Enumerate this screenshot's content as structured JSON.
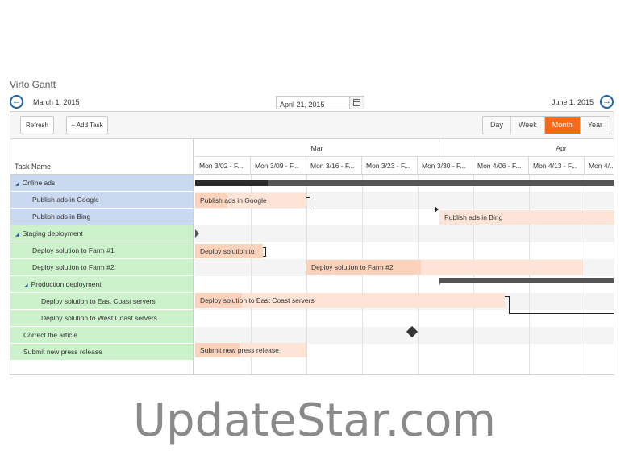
{
  "app": {
    "title": "Virto Gantt"
  },
  "nav": {
    "start_date": "March 1, 2015",
    "selected_date": "April 21, 2015",
    "end_date": "June 1, 2015"
  },
  "toolbar": {
    "refresh_label": "Refresh",
    "add_task_label": "+ Add Task",
    "views": [
      "Day",
      "Week",
      "Month",
      "Year"
    ],
    "active_view": "Month"
  },
  "task_list": {
    "header": "Task Name",
    "rows": [
      {
        "label": "Online ads",
        "color": "#c9d9ef"
      },
      {
        "label": "Publish ads in Google",
        "color": "#c9d9ef"
      },
      {
        "label": "Publish ads in Bing",
        "color": "#c9d9ef"
      },
      {
        "label": "Staging deployment",
        "color": "#ccf2cc"
      },
      {
        "label": "Deploy solution to Farm #1",
        "color": "#ccf2cc"
      },
      {
        "label": "Deploy solution to Farm #2",
        "color": "#ccf2cc"
      },
      {
        "label": "Production deployment",
        "color": "#ccf2cc"
      },
      {
        "label": "Deploy solution to East Coast servers",
        "color": "#ccf2cc"
      },
      {
        "label": "Deploy solution to West Coast servers",
        "color": "#ccf2cc"
      },
      {
        "label": "Correct the article",
        "color": "#ccf2cc"
      },
      {
        "label": "Submit new press release",
        "color": "#ccf2cc"
      }
    ]
  },
  "timeline": {
    "months": [
      "Mar",
      "Apr"
    ],
    "weeks": [
      "Mon 3/02 - F...",
      "Mon 3/09 - F...",
      "Mon 3/16 - F...",
      "Mon 3/23 - F...",
      "Mon 3/30 - F...",
      "Mon 4/06 - F...",
      "Mon 4/13 - F...",
      "Mon 4/..."
    ],
    "bars": {
      "google": "Publish ads in Google",
      "bing": "Publish ads in Bing",
      "farm1": "Deploy solution to",
      "farm2": "Deploy solution to Farm #2",
      "east": "Deploy solution to East Coast servers",
      "press": "Submit new press release"
    }
  },
  "watermark": "UpdateStar.com",
  "colors": {
    "accent": "#f26b1d",
    "nav": "#1e62a8",
    "bar": "#fde4d6"
  }
}
